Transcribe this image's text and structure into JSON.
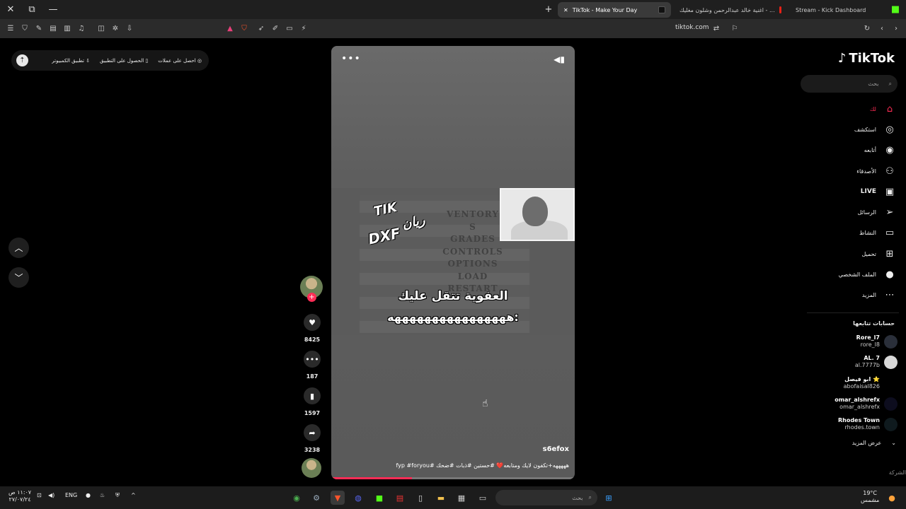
{
  "browser": {
    "tabs": [
      {
        "title": "TikTok - Make Your Day",
        "active": true
      },
      {
        "title": "اغنية خالد عبدالرحمن وشلون مغليك - ...",
        "active": false
      },
      {
        "title": "Stream - Kick Dashboard",
        "active": false
      }
    ],
    "url": "tiktok.com"
  },
  "topbar": {
    "coins": "احصل على عملات",
    "get_app": "الحصول على التطبيق",
    "desktop_app": "تطبيق الكمبيوتر"
  },
  "video": {
    "overlay_line1": "العفوية تتقل عليك",
    "overlay_line2": "ههههههههههههههههه:",
    "sticker_tik": "TIK",
    "sticker_name": "ريان",
    "sticker_dxf": "DXF",
    "menu_lines": [
      "VENTORY",
      "S",
      "GRADES",
      "CONTROLS",
      "OPTIONS",
      "LOAD",
      "RESTART"
    ],
    "author": "s6efox",
    "description": "هههههه+تكفون لايك ومتابعه❤️ #حستين #ذبات #ضحك #fyp #foryou",
    "progress": 0.33
  },
  "actions": {
    "likes": "8425",
    "comments": "187",
    "saves": "1597",
    "shares": "3238"
  },
  "sidebar": {
    "logo": "TikTok",
    "search_placeholder": "بحث",
    "nav": [
      {
        "label": "لك",
        "icon": "home-icon"
      },
      {
        "label": "استكشف",
        "icon": "compass-icon"
      },
      {
        "label": "أتابعه",
        "icon": "following-icon"
      },
      {
        "label": "الأصدقاء",
        "icon": "friends-icon"
      },
      {
        "label": "LIVE",
        "icon": "live-icon"
      },
      {
        "label": "الرسائل",
        "icon": "send-icon"
      },
      {
        "label": "النشاط",
        "icon": "activity-icon"
      },
      {
        "label": "تحميل",
        "icon": "upload-icon"
      },
      {
        "label": "الملف الشخصي",
        "icon": "profile-icon"
      },
      {
        "label": "المزيد",
        "icon": "more-icon"
      }
    ],
    "following_title": "حسابات تتابعها",
    "following": [
      {
        "name": "Rore_l7",
        "handle": "rore_l8"
      },
      {
        "name": "AL. 7",
        "handle": "al.7777b"
      },
      {
        "name": "ابو فيصل ⭐",
        "handle": "abofaisal826"
      },
      {
        "name": "omar_alshrefx",
        "handle": "omar_alshrefx"
      },
      {
        "name": "Rhodes Town",
        "handle": "rhodes.town"
      }
    ],
    "see_more": "عرض المزيد",
    "company": "الشركة"
  },
  "taskbar": {
    "time": "١١:٠٧ ص",
    "date": "٢٧/٠٧/٢٤",
    "lang": "ENG",
    "search": "بحث",
    "weather_temp": "19°C",
    "weather_desc": "مشمس"
  },
  "colors": {
    "accent": "#fe2c55"
  }
}
